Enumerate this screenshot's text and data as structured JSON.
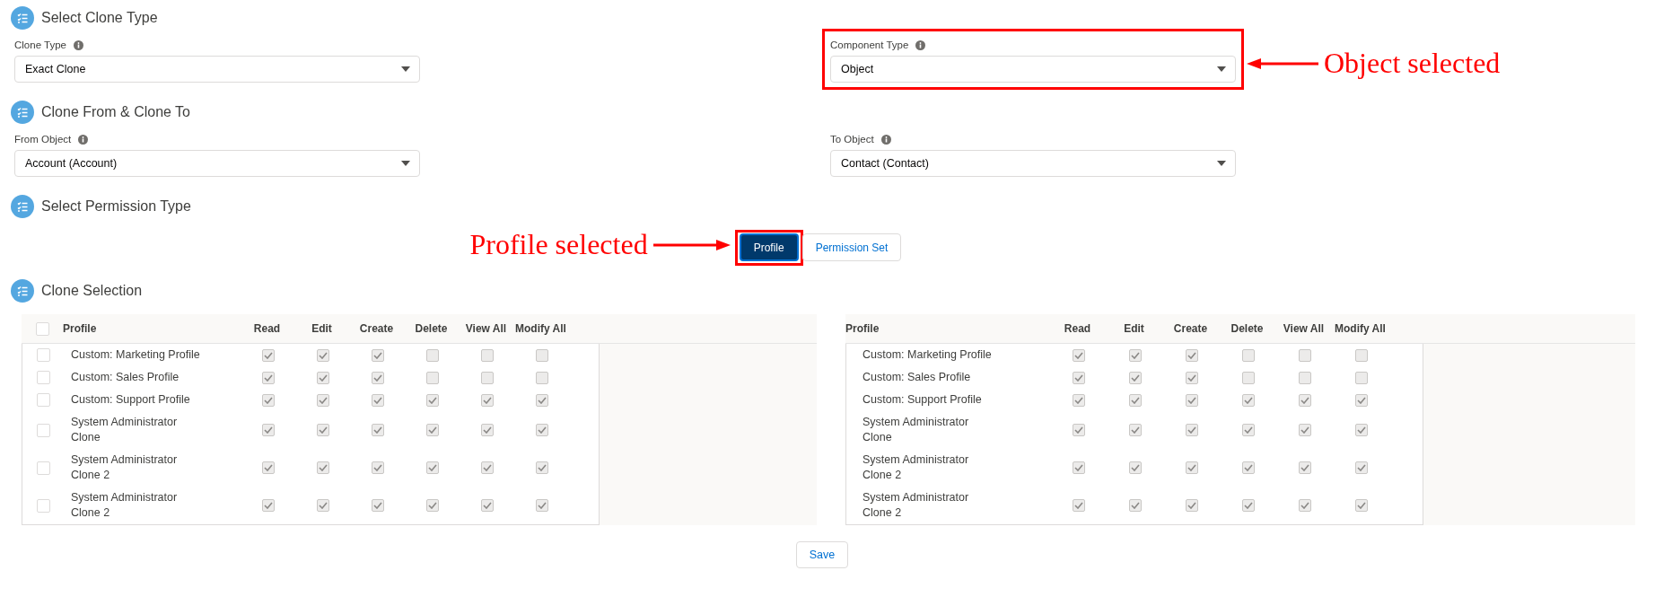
{
  "sections": [
    {
      "kind": "fields",
      "title": "Select Clone Type",
      "fields": [
        {
          "label": "Clone Type",
          "value": "Exact Clone"
        },
        {
          "label": "Component Type",
          "value": "Object",
          "annotation": "Object selected"
        }
      ]
    },
    {
      "kind": "fields",
      "title": "Clone From & Clone To",
      "fields": [
        {
          "label": "From Object",
          "value": "Account (Account)"
        },
        {
          "label": "To Object",
          "value": "Contact (Contact)"
        }
      ]
    },
    {
      "kind": "choice",
      "title": "Select Permission Type",
      "options": [
        {
          "label": "Profile",
          "selected": true,
          "annotation": "Profile selected"
        },
        {
          "label": "Permission Set",
          "selected": false
        }
      ]
    },
    {
      "kind": "tables",
      "title": "Clone Selection",
      "tables": [
        {
          "all_checked": false,
          "columns": [
            "Profile",
            "Read",
            "Edit",
            "Create",
            "Delete",
            "View All",
            "Modify All"
          ],
          "rows": [
            {
              "checked": false,
              "name": "Custom: Marketing Profile",
              "permissions": [
                true,
                true,
                true,
                false,
                false,
                false
              ]
            },
            {
              "checked": false,
              "name": "Custom: Sales Profile",
              "permissions": [
                true,
                true,
                true,
                false,
                false,
                false
              ]
            },
            {
              "checked": false,
              "name": "Custom: Support Profile",
              "permissions": [
                true,
                true,
                true,
                true,
                true,
                true
              ]
            },
            {
              "checked": false,
              "name": "System Administrator Clone",
              "permissions": [
                true,
                true,
                true,
                true,
                true,
                true
              ]
            },
            {
              "checked": false,
              "name": "System Administrator Clone 2",
              "permissions": [
                true,
                true,
                true,
                true,
                true,
                true
              ]
            },
            {
              "checked": false,
              "name": "System Administrator Clone 2",
              "permissions": [
                true,
                true,
                true,
                true,
                true,
                true
              ]
            }
          ]
        },
        {
          "columns": [
            "Profile",
            "Read",
            "Edit",
            "Create",
            "Delete",
            "View All",
            "Modify All"
          ],
          "rows": [
            {
              "name": "Custom: Marketing Profile",
              "permissions": [
                true,
                true,
                true,
                false,
                false,
                false
              ]
            },
            {
              "name": "Custom: Sales Profile",
              "permissions": [
                true,
                true,
                true,
                false,
                false,
                false
              ]
            },
            {
              "name": "Custom: Support Profile",
              "permissions": [
                true,
                true,
                true,
                true,
                true,
                true
              ]
            },
            {
              "name": "System Administrator Clone",
              "permissions": [
                true,
                true,
                true,
                true,
                true,
                true
              ]
            },
            {
              "name": "System Administrator Clone 2",
              "permissions": [
                true,
                true,
                true,
                true,
                true,
                true
              ]
            },
            {
              "name": "System Administrator Clone 2",
              "permissions": [
                true,
                true,
                true,
                true,
                true,
                true
              ]
            }
          ]
        }
      ]
    }
  ],
  "save_button": "Save"
}
